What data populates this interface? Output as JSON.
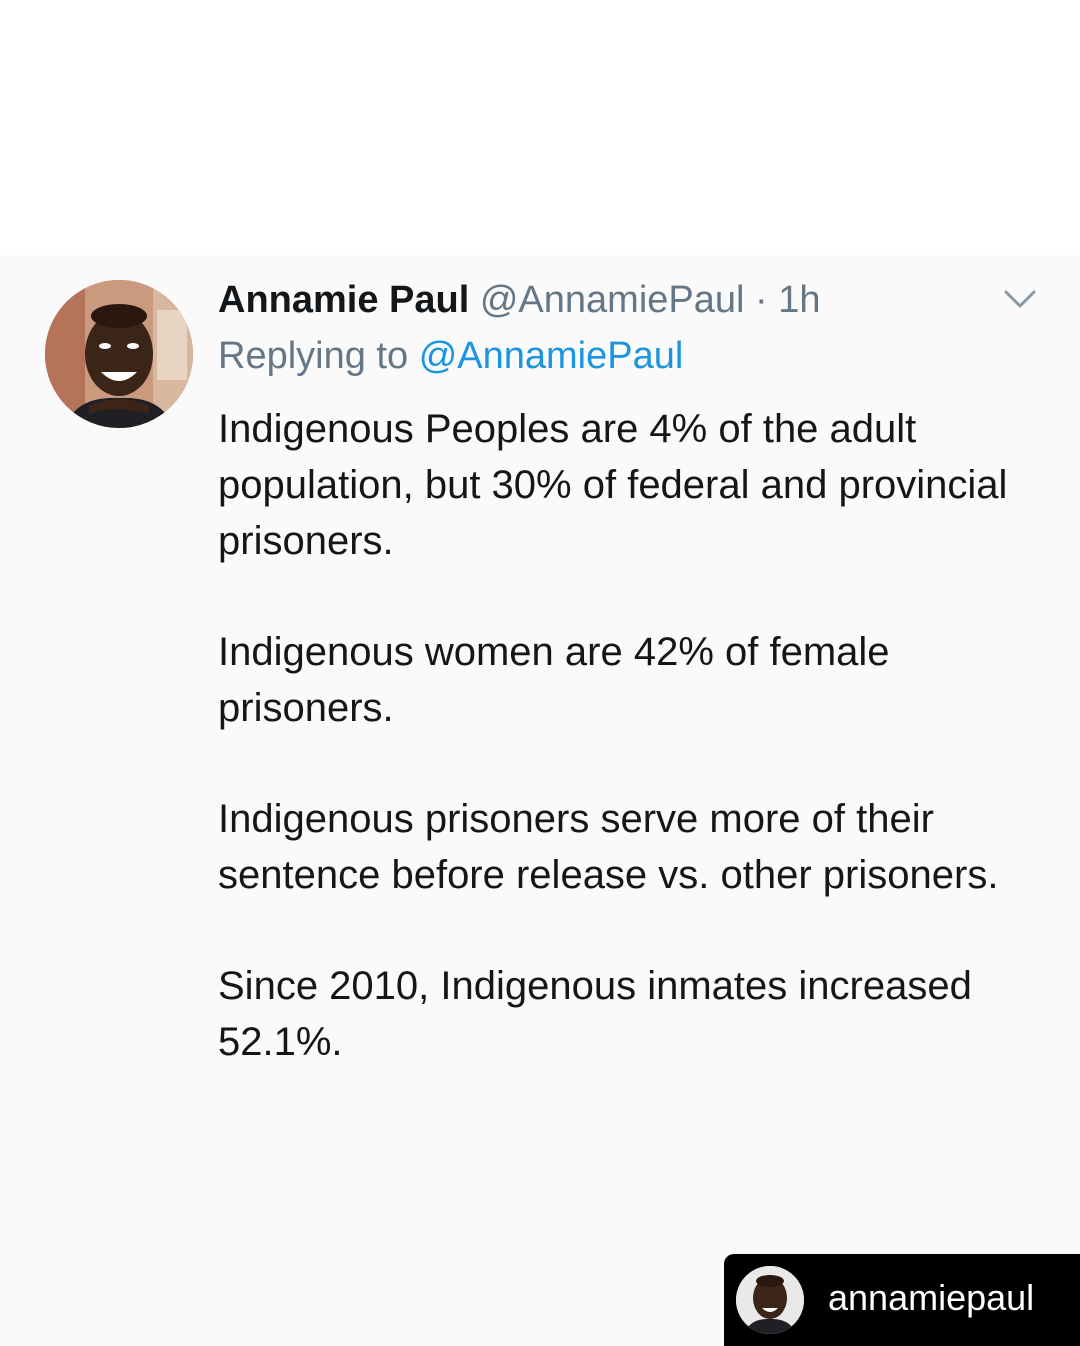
{
  "tweet": {
    "display_name": "Annamie Paul",
    "handle": "@AnnamiePaul",
    "separator": "·",
    "timestamp": "1h",
    "reply_prefix": "Replying to",
    "reply_target": "@AnnamiePaul",
    "paragraphs": [
      "Indigenous Peoples are 4% of the adult population, but 30% of federal and provincial prisoners.",
      "Indigenous women are 42% of female prisoners.",
      "Indigenous prisoners serve more of their sentence before release vs. other prisoners.",
      "Since 2010, Indigenous inmates increased 52.1%."
    ],
    "menu_icon": "chevron-down-icon",
    "link_color": "#1b95e0",
    "muted_color": "#657786"
  },
  "repost": {
    "username": "annamiepaul"
  }
}
